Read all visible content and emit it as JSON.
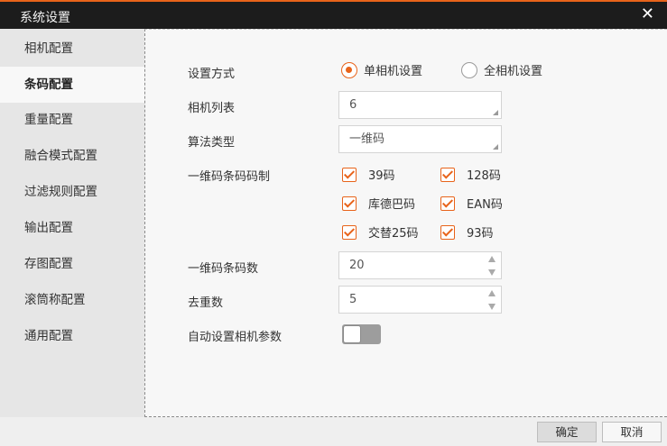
{
  "window": {
    "title": "系统设置",
    "close_glyph": "✕"
  },
  "sidebar": {
    "items": [
      {
        "label": "相机配置",
        "active": false
      },
      {
        "label": "条码配置",
        "active": true
      },
      {
        "label": "重量配置",
        "active": false
      },
      {
        "label": "融合模式配置",
        "active": false
      },
      {
        "label": "过滤规则配置",
        "active": false
      },
      {
        "label": "输出配置",
        "active": false
      },
      {
        "label": "存图配置",
        "active": false
      },
      {
        "label": "滚筒称配置",
        "active": false
      },
      {
        "label": "通用配置",
        "active": false
      }
    ]
  },
  "form": {
    "mode_label": "设置方式",
    "mode_options": {
      "single": "单相机设置",
      "all": "全相机设置",
      "selected": "single"
    },
    "camera_list_label": "相机列表",
    "camera_list_value": "6",
    "algo_label": "算法类型",
    "algo_value": "一维码",
    "barcode_types_label": "一维码条码码制",
    "barcode_types": [
      {
        "label": "39码",
        "checked": true
      },
      {
        "label": "128码",
        "checked": true
      },
      {
        "label": "库德巴码",
        "checked": true
      },
      {
        "label": "EAN码",
        "checked": true
      },
      {
        "label": "交替25码",
        "checked": true
      },
      {
        "label": "93码",
        "checked": true
      }
    ],
    "barcode_count_label": "一维码条码数",
    "barcode_count_value": "20",
    "dedup_label": "去重数",
    "dedup_value": "5",
    "auto_label": "自动设置相机参数",
    "auto_enabled": false
  },
  "footer": {
    "ok_label": "确定",
    "cancel_label": "取消"
  },
  "colors": {
    "accent": "#e8631a",
    "titlebar": "#1c1c1c"
  }
}
